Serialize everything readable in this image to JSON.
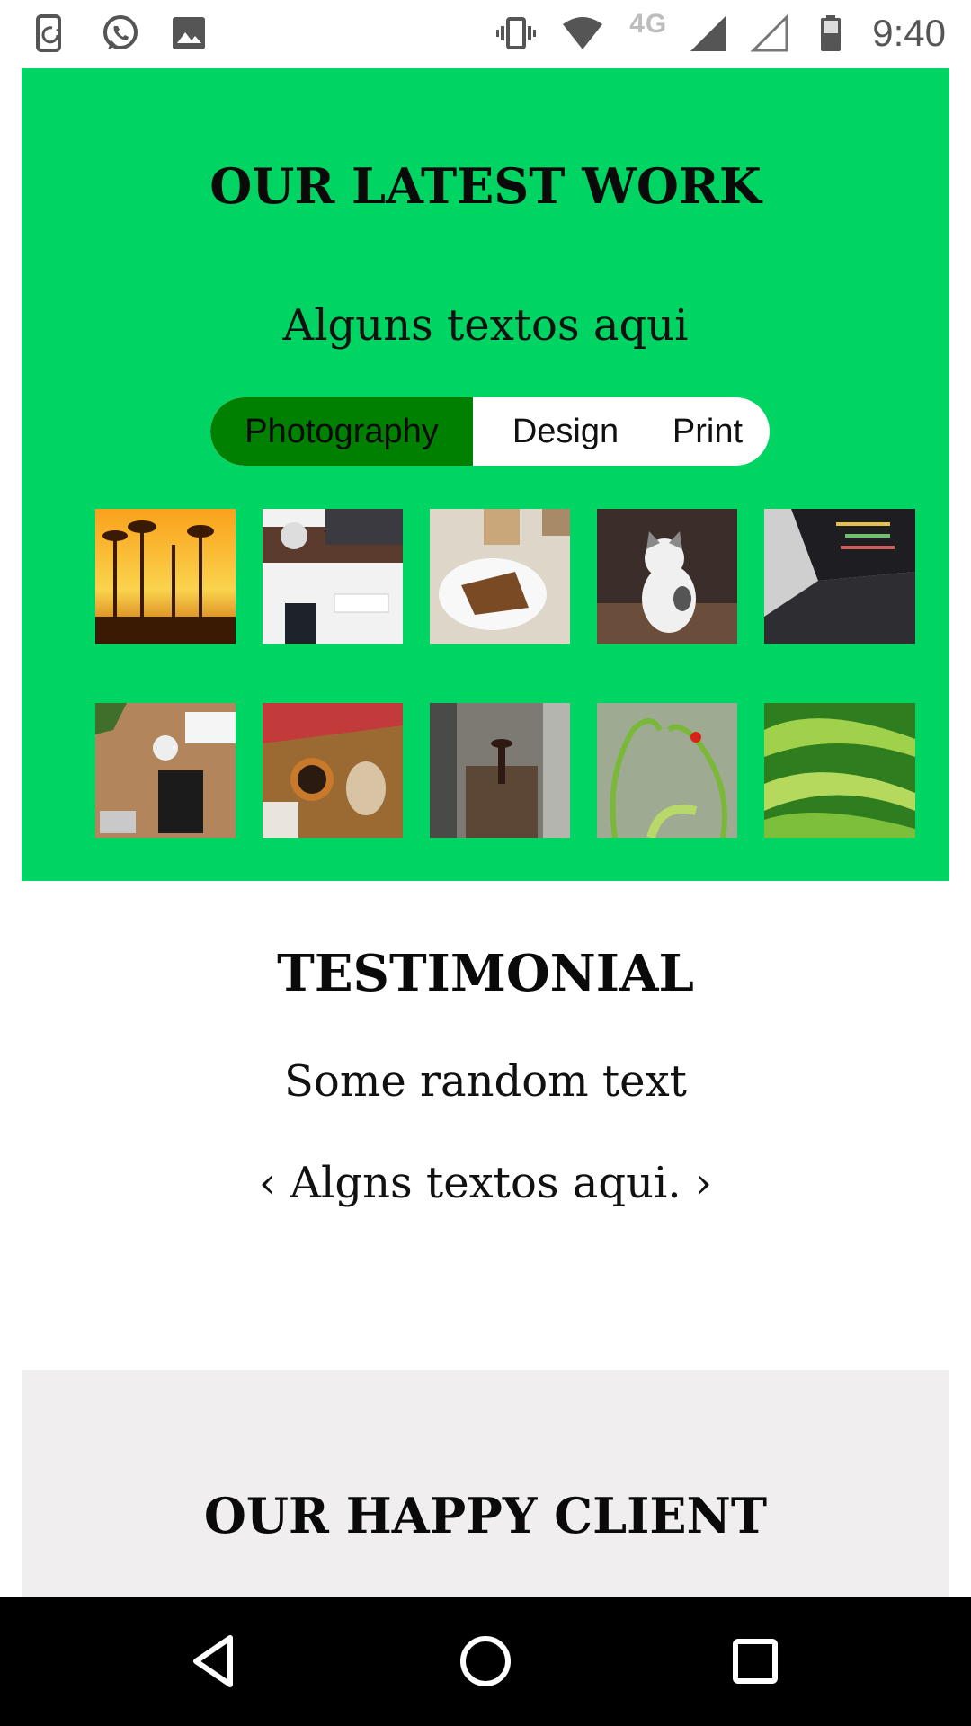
{
  "status_bar": {
    "left_icons": [
      "phone-sync-icon",
      "whatsapp-icon",
      "image-icon"
    ],
    "right_icons": [
      "vibrate-icon",
      "wifi-icon",
      "signal-icon",
      "signal-empty-icon",
      "battery-icon"
    ],
    "network": "4G",
    "time": "9:40"
  },
  "work": {
    "title": "OUR LATEST WORK",
    "subtitle": "Alguns textos aqui",
    "filters": [
      "Photography",
      "Design",
      "Print"
    ],
    "active_filter": "Photography",
    "accent_color": "#00d463",
    "active_color": "#008000",
    "thumbnails": [
      "sunset-trees",
      "desk-camera",
      "cake-coffee",
      "kitten",
      "laptop-code",
      "desk-notebook",
      "baking-table",
      "rail-spike",
      "ladybug-plant",
      "green-abstract"
    ]
  },
  "testimonial": {
    "title": "TESTIMONIAL",
    "subtitle": "Some random text",
    "quote": "‹ Algns textos aqui. ›"
  },
  "clients": {
    "title": "OUR HAPPY CLIENT",
    "background": "#f1eeef"
  },
  "nav_bar": {
    "buttons": [
      "back-icon",
      "home-icon",
      "recents-icon"
    ]
  }
}
